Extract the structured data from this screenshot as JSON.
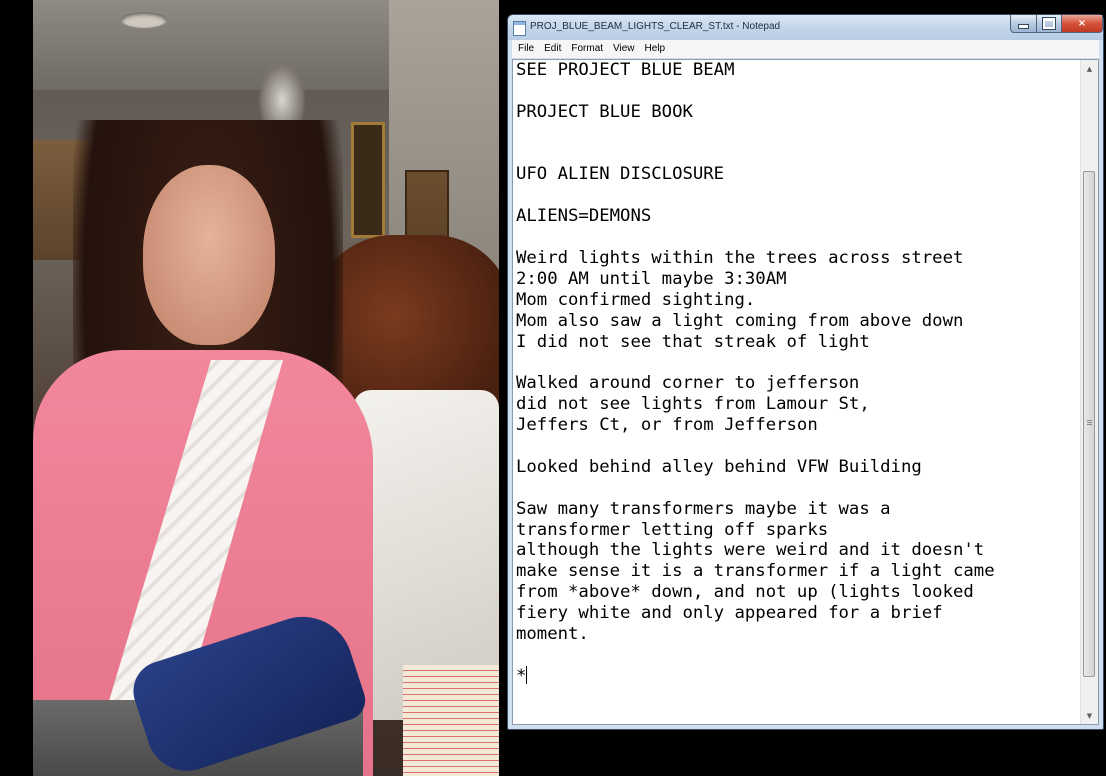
{
  "window": {
    "title": "PROJ_BLUE_BEAM_LIGHTS_CLEAR_ST.txt - Notepad",
    "controls": {
      "minimize": "minimize",
      "maximize": "maximize",
      "close": "×"
    }
  },
  "menu": [
    "File",
    "Edit",
    "Format",
    "View",
    "Help"
  ],
  "document": {
    "lines": [
      "SEE PROJECT BLUE BEAM",
      "",
      "PROJECT BLUE BOOK",
      "",
      "",
      "UFO ALIEN DISCLOSURE",
      "",
      "ALIENS=DEMONS",
      "",
      "Weird lights within the trees across street",
      "2:00 AM until maybe 3:30AM",
      "Mom confirmed sighting.",
      "Mom also saw a light coming from above down",
      "I did not see that streak of light",
      "",
      "Walked around corner to jefferson",
      "did not see lights from Lamour St,",
      "Jeffers Ct, or from Jefferson",
      "",
      "Looked behind alley behind VFW Building",
      "",
      "Saw many transformers maybe it was a",
      "transformer letting off sparks",
      "although the lights were weird and it doesn't",
      "make sense it is a transformer if a light came",
      "from *above* down, and not up (lights looked",
      "fiery white and only appeared for a brief",
      "moment.",
      "",
      "*"
    ]
  },
  "colors": {
    "title_bar": "#c4d6ea",
    "close_button": "#d6533c",
    "editor_background": "#ffffff",
    "text": "#000000"
  }
}
